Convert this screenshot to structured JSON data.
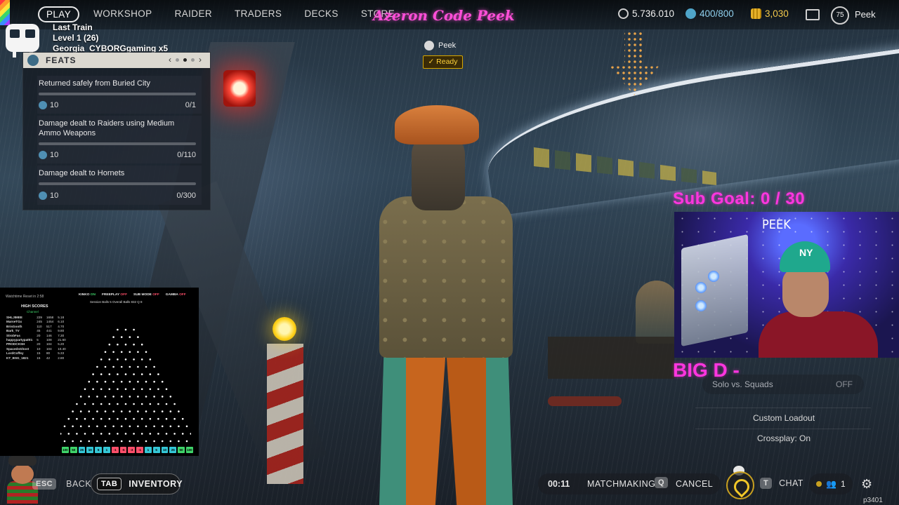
{
  "nav": {
    "items": [
      "PLAY",
      "WORKSHOP",
      "RAIDER",
      "TRADERS",
      "DECKS",
      "STORE"
    ],
    "brand": "Azeron Code Peek"
  },
  "currencies": {
    "coins": "5.736.010",
    "tokens": "400/800",
    "credits": "3,030"
  },
  "user": {
    "level": "75",
    "name": "Peek"
  },
  "train": {
    "line1": "Last Train",
    "line2": "Level 1  (26)",
    "line3": "Georgia_CYBORGgaming x5"
  },
  "feats": {
    "title": "FEATS",
    "items": [
      {
        "text": "Returned safely from Buried City",
        "reward": "10",
        "progress": "0/1"
      },
      {
        "text": "Damage dealt to Raiders using Medium Ammo Weapons",
        "reward": "10",
        "progress": "0/110"
      },
      {
        "text": "Damage dealt to Hornets",
        "reward": "10",
        "progress": "0/300"
      }
    ]
  },
  "party": {
    "name": "Peek",
    "status": "Ready"
  },
  "plinko": {
    "timer": "Watchtime Reset in 2:58",
    "hs_title": "HIGH SCORES",
    "hs_sub": "Channel",
    "scores": [
      [
        "SHLJIMEE",
        "229",
        "1658",
        "5.18"
      ],
      [
        "MarseTGx",
        "245",
        "1454",
        "6.10"
      ],
      [
        "BrisGooth",
        "110",
        "517",
        "4.70"
      ],
      [
        "Bark_TV",
        "45",
        "441",
        "9.80"
      ],
      [
        "StrobFas",
        "20",
        "146",
        "7.30"
      ],
      [
        "happypartypattt1",
        "5",
        "108",
        "21.60"
      ],
      [
        "PRODCKSH",
        "20",
        "104",
        "5.20"
      ],
      [
        "SpacedsGhost",
        "10",
        "104",
        "10.40"
      ],
      [
        "LordCoffey",
        "15",
        "80",
        "5.33"
      ],
      [
        "KT_BSG_1821",
        "15",
        "42",
        "2.80"
      ]
    ],
    "flags": [
      {
        "label": "KINKO",
        "state": "ON"
      },
      {
        "label": "FREEPLAY",
        "state": "OFF"
      },
      {
        "label": "SUB MODE",
        "state": "OFF"
      },
      {
        "label": "GAMBA",
        "state": "OFF"
      }
    ],
    "stats": "Session Balls  5     Overall Balls  832   Q  8",
    "slots": [
      "100",
      "50",
      "25",
      "10",
      "5",
      "1",
      "-1",
      "-5",
      "-3",
      "-1",
      "1",
      "5",
      "10",
      "25",
      "50",
      "100"
    ],
    "slot_colors": [
      "#3fd46a",
      "#3fd46a",
      "#34c7d6",
      "#34c7d6",
      "#34c7d6",
      "#34c7d6",
      "#ff4f6a",
      "#ff4f6a",
      "#ff4f6a",
      "#ff4f6a",
      "#34c7d6",
      "#34c7d6",
      "#34c7d6",
      "#34c7d6",
      "#3fd46a",
      "#3fd46a"
    ]
  },
  "stream": {
    "sub_goal": "Sub Goal:  0 / 30",
    "cam_name": "PEEK",
    "big_d": "BIG D -"
  },
  "options": {
    "solo_label": "Solo vs. Squads",
    "solo_value": "OFF",
    "custom_loadout": "Custom Loadout",
    "crossplay": "Crossplay: On"
  },
  "bottom": {
    "back_key": "ESC",
    "back_label": "BACK",
    "tab_key": "TAB",
    "inventory_label": "INVENTORY",
    "timer": "00:11",
    "matchmaking": "MATCHMAKING",
    "cancel_key": "Q",
    "cancel_label": "CANCEL",
    "chat_key": "T",
    "chat_label": "CHAT",
    "squad_count": "1",
    "player_id": "p3401"
  }
}
